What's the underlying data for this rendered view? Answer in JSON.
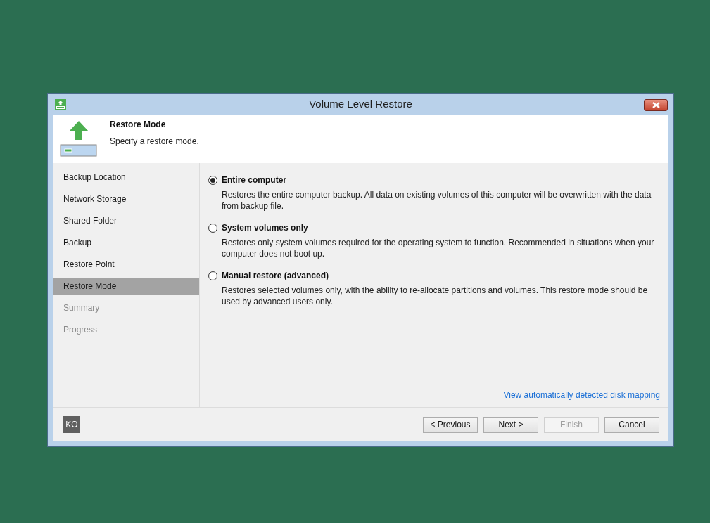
{
  "window": {
    "title": "Volume Level Restore"
  },
  "header": {
    "title": "Restore Mode",
    "subtitle": "Specify a restore mode."
  },
  "sidebar": {
    "items": [
      {
        "label": "Backup Location",
        "selected": false,
        "disabled": false
      },
      {
        "label": "Network Storage",
        "selected": false,
        "disabled": false
      },
      {
        "label": "Shared Folder",
        "selected": false,
        "disabled": false
      },
      {
        "label": "Backup",
        "selected": false,
        "disabled": false
      },
      {
        "label": "Restore Point",
        "selected": false,
        "disabled": false
      },
      {
        "label": "Restore Mode",
        "selected": true,
        "disabled": false
      },
      {
        "label": "Summary",
        "selected": false,
        "disabled": true
      },
      {
        "label": "Progress",
        "selected": false,
        "disabled": true
      }
    ]
  },
  "options": [
    {
      "label": "Entire computer",
      "description": "Restores the entire computer backup. All data on existing volumes of this computer will be overwritten with the data from backup file.",
      "selected": true
    },
    {
      "label": "System volumes only",
      "description": "Restores only system volumes required for the operating system to function. Recommended in situations when your computer does not boot up.",
      "selected": false
    },
    {
      "label": "Manual restore (advanced)",
      "description": "Restores selected volumes only, with the ability to re-allocate partitions and volumes. This restore mode should be used by advanced users only.",
      "selected": false
    }
  ],
  "link": "View automatically detected disk mapping",
  "footer": {
    "badge": "KO",
    "buttons": [
      {
        "label": "< Previous",
        "disabled": false
      },
      {
        "label": "Next >",
        "disabled": false
      },
      {
        "label": "Finish",
        "disabled": true
      },
      {
        "label": "Cancel",
        "disabled": false
      }
    ]
  }
}
